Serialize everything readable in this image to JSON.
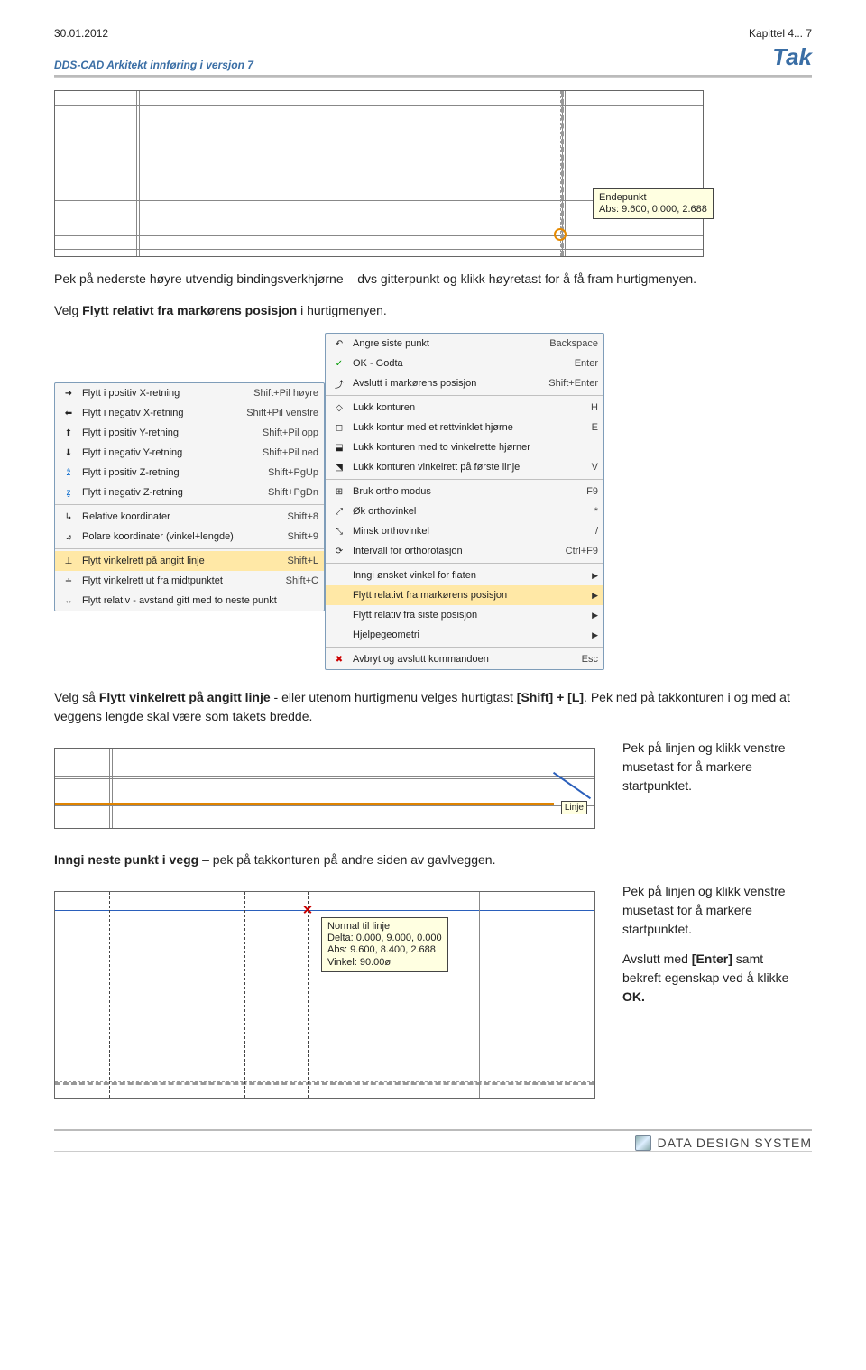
{
  "header": {
    "date": "30.01.2012",
    "chapter": "Kapittel 4... 7",
    "subtitle_left": "DDS-CAD Arkitekt innføring i versjon 7",
    "subtitle_right": "Tak"
  },
  "fig1_tooltip": {
    "line1": "Endepunkt",
    "line2": "Abs: 9.600, 0.000, 2.688"
  },
  "para1": {
    "t1": "Pek på nederste høyre utvendig bindingsverkhjørne – dvs gitterpunkt og klikk høyretast for å få fram hurtigmenyen.",
    "t2a": "Velg ",
    "t2b": "Flytt relativt fra markørens posisjon",
    "t2c": " i hurtigmenyen."
  },
  "main_menu": [
    {
      "label": "Angre siste punkt",
      "shortcut": "Backspace"
    },
    {
      "label": "OK - Godta",
      "shortcut": "Enter"
    },
    {
      "label": "Avslutt i markørens posisjon",
      "shortcut": "Shift+Enter"
    },
    {
      "label": "Lukk konturen",
      "shortcut": "H"
    },
    {
      "label": "Lukk kontur med et rettvinklet hjørne",
      "shortcut": "E"
    },
    {
      "label": "Lukk konturen med to vinkelrette hjørner",
      "shortcut": ""
    },
    {
      "label": "Lukk konturen vinkelrett på første linje",
      "shortcut": "V"
    },
    {
      "label": "Bruk ortho modus",
      "shortcut": "F9"
    },
    {
      "label": "Øk orthovinkel",
      "shortcut": "*"
    },
    {
      "label": "Minsk orthovinkel",
      "shortcut": "/"
    },
    {
      "label": "Intervall for orthorotasjon",
      "shortcut": "Ctrl+F9"
    },
    {
      "label": "Inngi ønsket vinkel for flaten",
      "shortcut": ""
    },
    {
      "label": "Flytt relativt fra markørens posisjon",
      "shortcut": "",
      "hl": true
    },
    {
      "label": "Flytt relativ fra siste posisjon",
      "shortcut": ""
    },
    {
      "label": "Hjelpegeometri",
      "shortcut": ""
    },
    {
      "label": "Avbryt og avslutt kommandoen",
      "shortcut": "Esc"
    }
  ],
  "sub_menu": [
    {
      "label": "Flytt i positiv X-retning",
      "shortcut": "Shift+Pil høyre"
    },
    {
      "label": "Flytt i negativ X-retning",
      "shortcut": "Shift+Pil venstre"
    },
    {
      "label": "Flytt i positiv Y-retning",
      "shortcut": "Shift+Pil opp"
    },
    {
      "label": "Flytt i negativ Y-retning",
      "shortcut": "Shift+Pil ned"
    },
    {
      "label": "Flytt i positiv Z-retning",
      "shortcut": "Shift+PgUp"
    },
    {
      "label": "Flytt i negativ Z-retning",
      "shortcut": "Shift+PgDn"
    },
    {
      "label": "Relative koordinater",
      "shortcut": "Shift+8"
    },
    {
      "label": "Polare koordinater (vinkel+lengde)",
      "shortcut": "Shift+9"
    },
    {
      "label": "Flytt vinkelrett på angitt linje",
      "shortcut": "Shift+L",
      "hl": true
    },
    {
      "label": "Flytt vinkelrett ut fra midtpunktet",
      "shortcut": "Shift+C"
    },
    {
      "label": "Flytt relativ - avstand gitt med to neste punkt",
      "shortcut": ""
    }
  ],
  "para2": {
    "t1a": "Velg så ",
    "t1b": "Flytt vinkelrett på angitt linje",
    "t1c": " - eller utenom hurtigmenu velges hurtigtast ",
    "t1d": "[Shift] + [L]",
    "t1e": ". Pek ned på takkonturen i og med at veggens lengde skal være som takets bredde."
  },
  "fig2_tag": "Linje",
  "caption2": "Pek på linjen og klikk venstre musetast for å markere startpunktet.",
  "para3": {
    "bold": "Inngi neste punkt i vegg",
    "rest": " – pek på takkonturen på andre siden av gavlveggen."
  },
  "fig3_tooltip": {
    "l1": "Normal til linje",
    "l2": "Delta: 0.000, 9.000, 0.000",
    "l3": "Abs: 9.600, 8.400, 2.688",
    "l4": "Vinkel: 90.00ø"
  },
  "caption3_a": "Pek på linjen og klikk venstre musetast for å markere startpunktet.",
  "caption3_b1": "Avslutt med ",
  "caption3_b2": "[Enter]",
  "caption3_b3": " samt bekreft egenskap ved å klikke ",
  "caption3_b4": "OK.",
  "footer": "DATA DESIGN SYSTEM"
}
